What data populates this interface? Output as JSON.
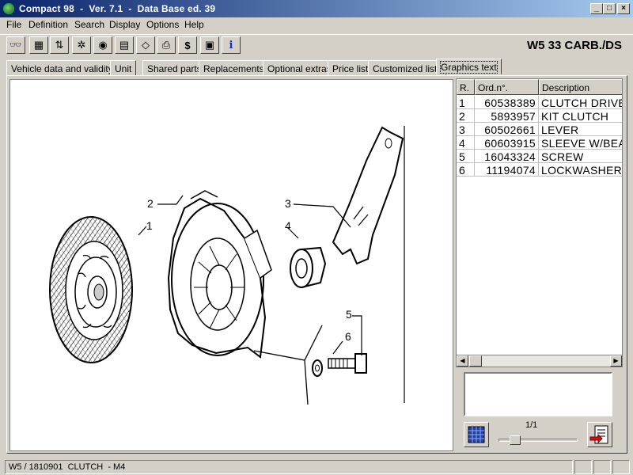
{
  "window": {
    "title": "Compact 98  -  Ver. 7.1  -  Data Base ed. 39",
    "controls": {
      "minimize": "_",
      "maximize": "□",
      "close": "×"
    }
  },
  "menu": [
    "File",
    "Definition",
    "Search",
    "Display",
    "Options",
    "Help"
  ],
  "toolbar": {
    "buttons": [
      {
        "name": "binoculars-icon",
        "glyph": "👓"
      },
      {
        "name": "grid-icon",
        "glyph": "▦"
      },
      {
        "name": "sort-icon",
        "glyph": "⇅"
      },
      {
        "name": "puzzle-icon",
        "glyph": "✲"
      },
      {
        "name": "target-icon",
        "glyph": "◉"
      },
      {
        "name": "document-icon",
        "glyph": "▤"
      },
      {
        "name": "eraser-icon",
        "glyph": "◇"
      },
      {
        "name": "printer-icon",
        "glyph": "⎙"
      },
      {
        "name": "dollar-icon",
        "glyph": "$"
      },
      {
        "name": "image-icon",
        "glyph": "▣"
      },
      {
        "name": "info-icon",
        "glyph": "i"
      }
    ],
    "model": "W5 33 CARB./DS"
  },
  "tabs": [
    {
      "label": "Vehicle data and validity"
    },
    {
      "label": "Unit"
    },
    {
      "label": "Shared parts"
    },
    {
      "label": "Replacements"
    },
    {
      "label": "Optional extras"
    },
    {
      "label": "Price list"
    },
    {
      "label": "Customized lists"
    },
    {
      "label": "Graphics text",
      "active": true
    }
  ],
  "parts_table": {
    "headers": [
      "R.",
      "Ord.n°.",
      "Description"
    ],
    "rows": [
      {
        "ref": "1",
        "ord": "60538389",
        "desc": "CLUTCH DRIVE"
      },
      {
        "ref": "2",
        "ord": "5893957",
        "desc": "KIT CLUTCH"
      },
      {
        "ref": "3",
        "ord": "60502661",
        "desc": "LEVER"
      },
      {
        "ref": "4",
        "ord": "60603915",
        "desc": "SLEEVE W/BEA"
      },
      {
        "ref": "5",
        "ord": "16043324",
        "desc": "SCREW"
      },
      {
        "ref": "6",
        "ord": "11194074",
        "desc": "LOCKWASHER"
      }
    ]
  },
  "drawing": {
    "callouts": [
      "1",
      "2",
      "3",
      "4",
      "5",
      "6"
    ]
  },
  "pager": {
    "page": "1/1"
  },
  "status": {
    "left": "W5 / 1810901  CLUTCH  - M4"
  }
}
